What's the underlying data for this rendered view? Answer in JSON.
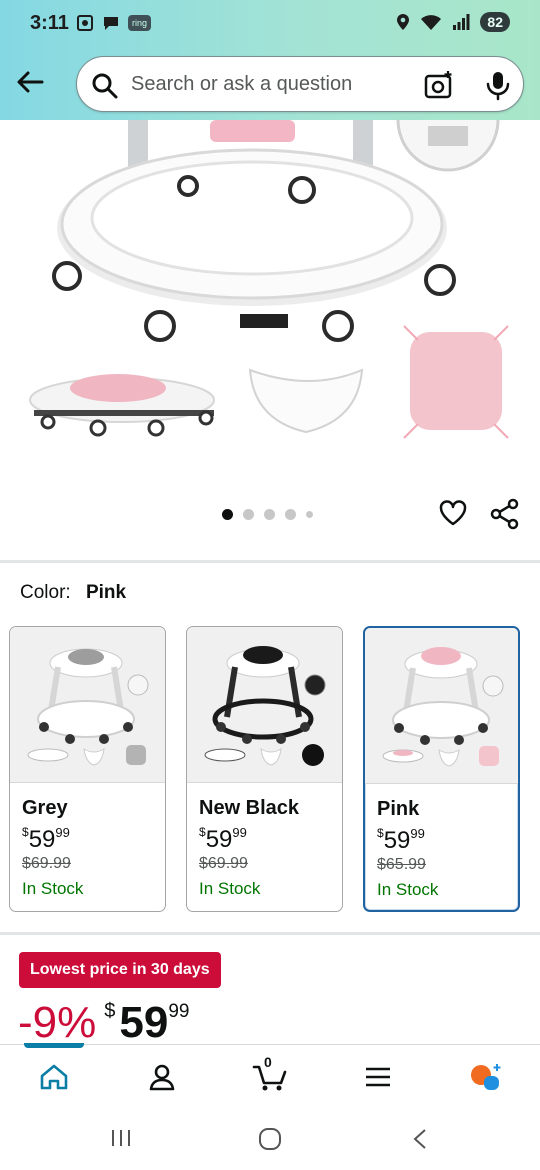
{
  "status_bar": {
    "time": "3:11",
    "notification_badge": "ring",
    "battery": "82",
    "icons_left": [
      "screenshot-icon",
      "chat-icon",
      "ring-icon"
    ],
    "icons_right": [
      "location-icon",
      "wifi-icon",
      "signal-icon",
      "battery-icon"
    ]
  },
  "header": {
    "search_placeholder": "Search or ask a question",
    "icons": [
      "back-arrow-icon",
      "search-icon",
      "camera-lens-icon",
      "microphone-icon"
    ]
  },
  "gallery": {
    "dot_count": 5,
    "active_index": 0
  },
  "variation": {
    "label": "Color:",
    "selected": "Pink",
    "options": [
      {
        "name": "Grey",
        "price_symbol": "$",
        "price_whole": "59",
        "price_frac": "99",
        "was": "$69.99",
        "stock": "In Stock",
        "selected": false,
        "accent": "#9d9d9d"
      },
      {
        "name": "New Black",
        "price_symbol": "$",
        "price_whole": "59",
        "price_frac": "99",
        "was": "$69.99",
        "stock": "In Stock",
        "selected": false,
        "accent": "#1a1a1a"
      },
      {
        "name": "Pink",
        "price_symbol": "$",
        "price_whole": "59",
        "price_frac": "99",
        "was": "$65.99",
        "stock": "In Stock",
        "selected": true,
        "accent": "#f0b7c3"
      }
    ]
  },
  "deal": {
    "badge": "Lowest price in 30 days",
    "discount": "-9%",
    "price_symbol": "$",
    "price_whole": "59",
    "price_frac": "99"
  },
  "bottom_nav": {
    "items": [
      "home-icon",
      "account-icon",
      "cart-icon",
      "menu-icon",
      "rufus-icon"
    ],
    "cart_count": "0"
  },
  "colors": {
    "header_gradient_start": "#84d8e3",
    "header_gradient_end": "#a9e6c9",
    "deal_red": "#cc0c39",
    "stock_green": "#007600",
    "selected_border": "#2162a1",
    "nav_active": "#0a7ea4"
  }
}
